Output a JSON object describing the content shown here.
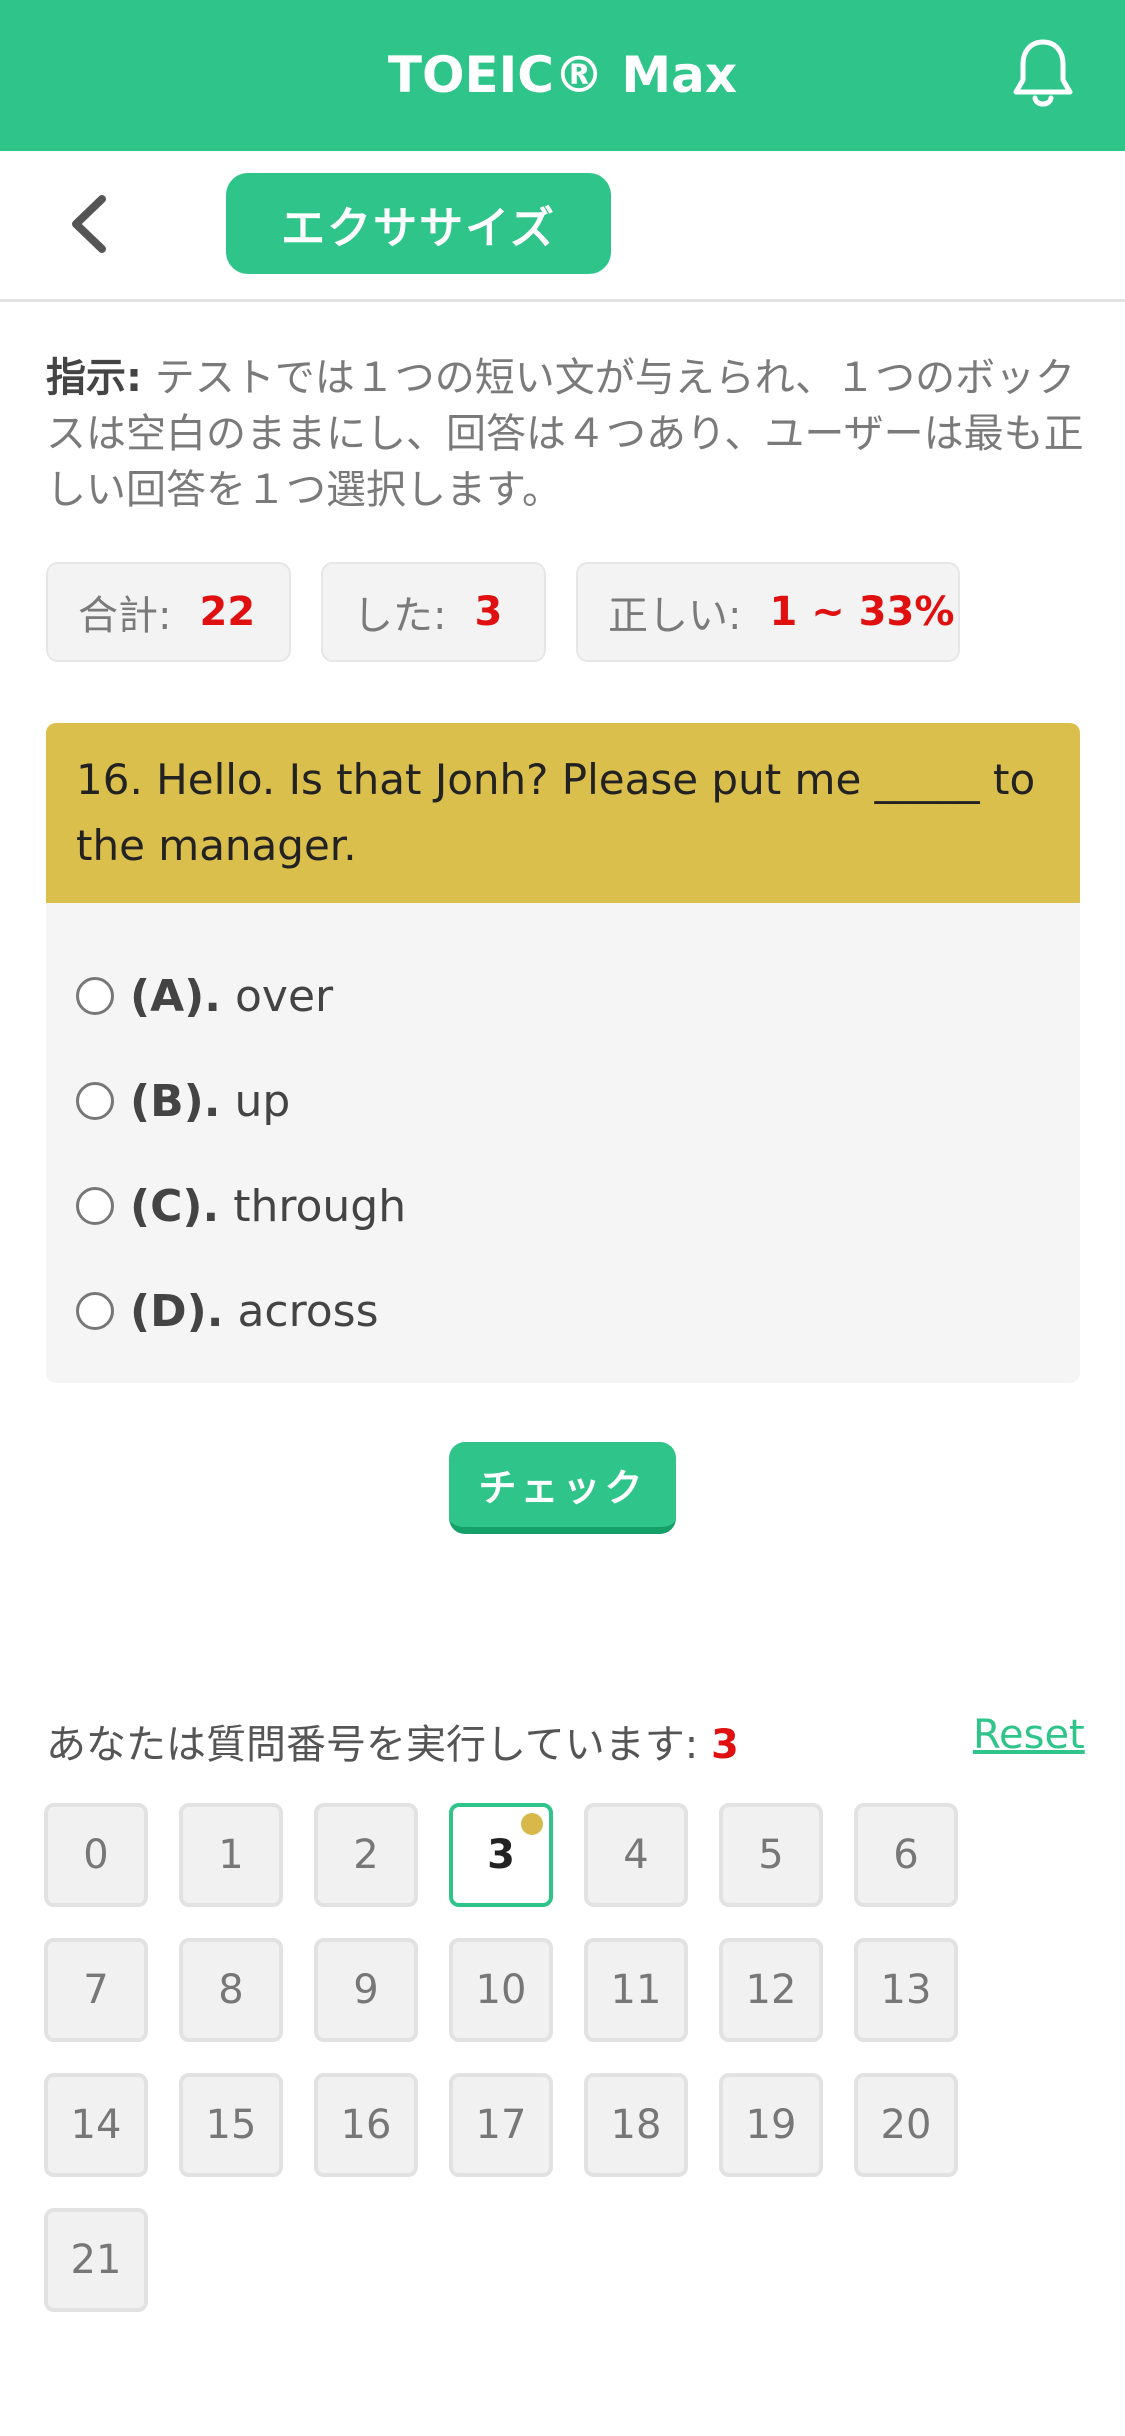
{
  "app": {
    "title": "TOEIC® Max"
  },
  "icons": {
    "notifications": "bell-icon",
    "back": "chevron-left-icon"
  },
  "colors": {
    "brand": "#2ec48a",
    "question_header": "#dbbf4d",
    "accent_red": "#e01010",
    "marker": "#d8b84b"
  },
  "subbar": {
    "tab_label": "エクササイズ"
  },
  "instruction": {
    "label": "指示:",
    "text": " テストでは１つの短い文が与えられ、１つのボックスは空白のままにし、回答は４つあり、ユーザーは最も正しい回答を１つ選択します。"
  },
  "stats": {
    "total_label": "合計:",
    "total_value": "22",
    "done_label": "した:",
    "done_value": "3",
    "correct_label": "正しい:",
    "correct_value": "1 ~ 33%"
  },
  "question": {
    "text": "16. Hello. Is that Jonh? Please put me _____ to the manager.",
    "options": [
      {
        "letter": "(A).",
        "text": "over"
      },
      {
        "letter": "(B).",
        "text": "up"
      },
      {
        "letter": "(C).",
        "text": "through"
      },
      {
        "letter": "(D).",
        "text": "across"
      }
    ]
  },
  "check_button": "チェック",
  "progress": {
    "label": "あなたは質問番号を実行しています:",
    "current": "3",
    "reset": "Reset"
  },
  "question_numbers": [
    "0",
    "1",
    "2",
    "3",
    "4",
    "5",
    "6",
    "7",
    "8",
    "9",
    "10",
    "11",
    "12",
    "13",
    "14",
    "15",
    "16",
    "17",
    "18",
    "19",
    "20",
    "21"
  ],
  "active_index": 3
}
